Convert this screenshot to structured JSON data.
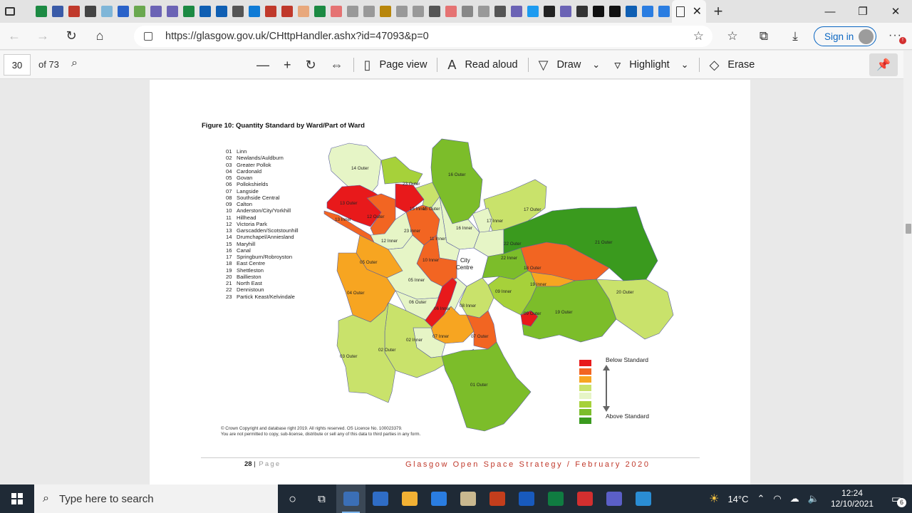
{
  "browser": {
    "url": "https://glasgow.gov.uk/CHttpHandler.ashx?id=47093&p=0",
    "sign_in_label": "Sign in",
    "tab_icons": [
      "#1c8a43",
      "#3a5ba8",
      "#c0392b",
      "#444",
      "#7fb6d8",
      "#2a62c9",
      "#6aa84f",
      "#6b63b5",
      "#6b63b5",
      "#1c8a43",
      "#0f5fb3",
      "#0f5fb3",
      "#555",
      "#0f7bd6",
      "#c0392b",
      "#c0392b",
      "#e8a87c",
      "#1c8a43",
      "#e57373",
      "#999",
      "#999",
      "#b8860b",
      "#999",
      "#999",
      "#555",
      "#e57373",
      "#888",
      "#999",
      "#555",
      "#6b63b5",
      "#1d9bf0",
      "#222",
      "#6b63b5",
      "#333",
      "#111",
      "#111",
      "#0f5fb3",
      "#2a7de1",
      "#2a7de1"
    ],
    "window_controls": [
      "—",
      "❐",
      "✕"
    ]
  },
  "pdf_toolbar": {
    "page_number": "30",
    "page_total": "of 73",
    "tools": [
      {
        "icon": "minus-icon",
        "glyph": "—",
        "label": ""
      },
      {
        "icon": "plus-icon",
        "glyph": "+",
        "label": ""
      },
      {
        "icon": "rotate-icon",
        "glyph": "↻",
        "label": ""
      },
      {
        "icon": "fit-width-icon",
        "glyph": "⇔",
        "label": ""
      },
      {
        "icon": "page-view-icon",
        "glyph": "▯",
        "label": "Page view"
      },
      {
        "icon": "read-aloud-icon",
        "glyph": "A",
        "label": "Read aloud"
      },
      {
        "icon": "draw-icon",
        "glyph": "▽",
        "label": "Draw"
      },
      {
        "icon": "highlight-icon",
        "glyph": "▿",
        "label": "Highlight"
      },
      {
        "icon": "erase-icon",
        "glyph": "◇",
        "label": "Erase"
      }
    ]
  },
  "document": {
    "figure_title": "Figure 10: Quantity Standard by Ward/Part of Ward",
    "wards": [
      {
        "num": "01",
        "name": "Linn"
      },
      {
        "num": "02",
        "name": "Newlands/Auldburn"
      },
      {
        "num": "03",
        "name": "Greater Pollok"
      },
      {
        "num": "04",
        "name": "Cardonald"
      },
      {
        "num": "05",
        "name": "Govan"
      },
      {
        "num": "06",
        "name": "Pollokshields"
      },
      {
        "num": "07",
        "name": "Langside"
      },
      {
        "num": "08",
        "name": "Southside Central"
      },
      {
        "num": "09",
        "name": "Calton"
      },
      {
        "num": "10",
        "name": "Anderston/City/Yorkhill"
      },
      {
        "num": "11",
        "name": "Hillhead"
      },
      {
        "num": "12",
        "name": "Victoria Park"
      },
      {
        "num": "13",
        "name": "Garscadden/Scotstounhill"
      },
      {
        "num": "14",
        "name": "Drumchapel/Anniesland"
      },
      {
        "num": "15",
        "name": "Maryhill"
      },
      {
        "num": "16",
        "name": "Canal"
      },
      {
        "num": "17",
        "name": "Springburn/Robroyston"
      },
      {
        "num": "18",
        "name": "East Centre"
      },
      {
        "num": "19",
        "name": "Shettleston"
      },
      {
        "num": "20",
        "name": "Baillieston"
      },
      {
        "num": "21",
        "name": "North East"
      },
      {
        "num": "22",
        "name": "Dennistoun"
      },
      {
        "num": "23",
        "name": "Partick Keast/Kelvindale"
      }
    ],
    "map_labels": [
      "14 Outer",
      "13 Outer",
      "13 Inner",
      "12 Outer",
      "23 Outer",
      "15 Inner",
      "15 Outer",
      "16 Outer",
      "17 Outer",
      "17 Inner",
      "16 Inner",
      "23 Inner",
      "11 Inner",
      "12 Inner",
      "City Centre",
      "22 Outer",
      "21 Outer",
      "22 Inner",
      "10 Inner",
      "05 Outer",
      "05 Inner",
      "18 Outer",
      "19 Inner",
      "09 Inner",
      "04 Outer",
      "06 Outer",
      "08 Inner",
      "06 Inner",
      "09 Outer",
      "19 Outer",
      "20 Outer",
      "07 Inner",
      "07 Outer",
      "02 Inner",
      "02 Outer",
      "03 Outer",
      "01 Outer"
    ],
    "legend": {
      "top_label": "Below Standard",
      "bottom_label": "Above Standard",
      "scale_colors": [
        "#e8191b",
        "#f26522",
        "#f7a521",
        "#c9e26b",
        "#e6f5c6",
        "#a6d13a",
        "#7cbd2a",
        "#3a9a1e"
      ]
    },
    "copyright_line1": "© Crown Copyright and database right 2019. All rights reserved. OS Licence No. 100023379.",
    "copyright_line2": "You are not permitted to copy, sub-license, distribute or sell any of this data to third parties in any form.",
    "footer_page_number": "28",
    "footer_page_word": "Page",
    "footer_title": "Glasgow Open Space Strategy / February 2020"
  },
  "taskbar": {
    "search_placeholder": "Type here to search",
    "apps": [
      "#3b6fb6",
      "#2f6dc6",
      "#f2b134",
      "#2a7de1",
      "#c9b88f",
      "#c43e1c",
      "#185abd",
      "#107c41",
      "#d32f2f",
      "#5b5fc7",
      "#2a8dd4"
    ],
    "weather": "14°C",
    "time": "12:24",
    "date": "12/10/2021",
    "notification_count": "6"
  }
}
